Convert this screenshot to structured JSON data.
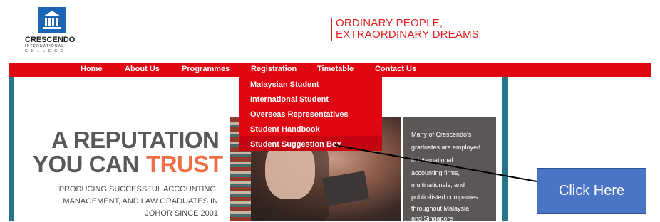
{
  "logo": {
    "name": "CRESCENDO",
    "subtitle_1": "INTERNATIONAL",
    "subtitle_2": "COLLEGE",
    "emblem": "building-emblem-icon"
  },
  "tagline": {
    "line1": "ORDINARY PEOPLE,",
    "line2": "EXTRAORDINARY DREAMS"
  },
  "nav": {
    "items": [
      "Home",
      "About Us",
      "Programmes",
      "Registration",
      "Timetable",
      "Contact Us"
    ]
  },
  "dropdown": {
    "items": [
      "Malaysian Student",
      "International Student",
      "Overseas Representatives",
      "Student Handbook",
      "Student Suggestion Box"
    ]
  },
  "hero": {
    "headline_1": "A REPUTATION",
    "headline_2a": "YOU CAN",
    "headline_2b": "TRUST",
    "sub_1": "PRODUCING SUCCESSFUL ACCOUNTING,",
    "sub_2": "MANAGEMENT, AND LAW GRADUATES IN",
    "sub_3": "JOHOR SINCE 2001"
  },
  "info_box": {
    "lines": [
      "Many of Crescendo's",
      "graduates are employed",
      "in international",
      "accounting firms,",
      "multinationals, and",
      "public-listed companies",
      "throughout Malaysia",
      "and Singapore"
    ]
  },
  "callout": {
    "label": "Click Here"
  },
  "colors": {
    "nav_red": "#e10712",
    "accent_orange": "#ef6e46",
    "callout_blue": "#4a74c4",
    "teal_border": "#26748a"
  }
}
